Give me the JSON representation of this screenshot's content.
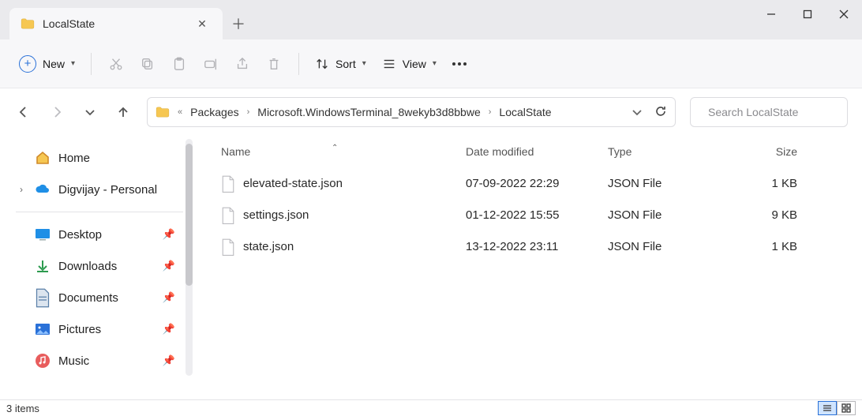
{
  "window": {
    "tab_title": "LocalState"
  },
  "toolbar": {
    "new_label": "New",
    "sort_label": "Sort",
    "view_label": "View"
  },
  "breadcrumb": {
    "segments": [
      "Packages",
      "Microsoft.WindowsTerminal_8wekyb3d8bbwe",
      "LocalState"
    ]
  },
  "search": {
    "placeholder": "Search LocalState"
  },
  "columns": {
    "name": "Name",
    "date": "Date modified",
    "type": "Type",
    "size": "Size"
  },
  "files": [
    {
      "name": "elevated-state.json",
      "date": "07-09-2022 22:29",
      "type": "JSON File",
      "size": "1 KB"
    },
    {
      "name": "settings.json",
      "date": "01-12-2022 15:55",
      "type": "JSON File",
      "size": "9 KB"
    },
    {
      "name": "state.json",
      "date": "13-12-2022 23:11",
      "type": "JSON File",
      "size": "1 KB"
    }
  ],
  "nav": {
    "home": "Home",
    "personal": "Digvijay - Personal",
    "desktop": "Desktop",
    "downloads": "Downloads",
    "documents": "Documents",
    "pictures": "Pictures",
    "music": "Music"
  },
  "status": {
    "count_text": "3 items"
  },
  "colors": {
    "accent": "#2a71d8"
  }
}
